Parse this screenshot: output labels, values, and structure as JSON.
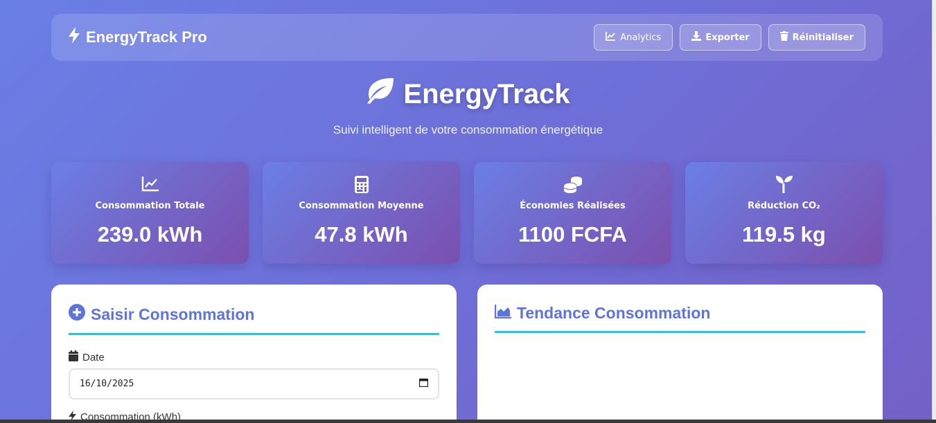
{
  "nav": {
    "brand": "EnergyTrack Pro",
    "buttons": {
      "analytics": "Analytics",
      "export": "Exporter",
      "reset": "Réinitialiser"
    }
  },
  "hero": {
    "title": "EnergyTrack",
    "subtitle": "Suivi intelligent de votre consommation énergétique"
  },
  "stats": [
    {
      "label": "Consommation Totale",
      "value": "239.0 kWh",
      "icon": "chart-line-icon"
    },
    {
      "label": "Consommation Moyenne",
      "value": "47.8 kWh",
      "icon": "calculator-icon"
    },
    {
      "label": "Économies Réalisées",
      "value": "1100 FCFA",
      "icon": "coins-icon"
    },
    {
      "label": "Réduction CO₂",
      "value": "119.5 kg",
      "icon": "seedling-icon"
    }
  ],
  "form_panel": {
    "title": "Saisir Consommation",
    "date_label": "Date",
    "date_value": "16/10/2025",
    "consumption_label": "Consommation (kWh)"
  },
  "trend_panel": {
    "title": "Tendance Consommation"
  },
  "colors": {
    "accent": "#5f74d8",
    "underline": "#1ec8e8"
  }
}
